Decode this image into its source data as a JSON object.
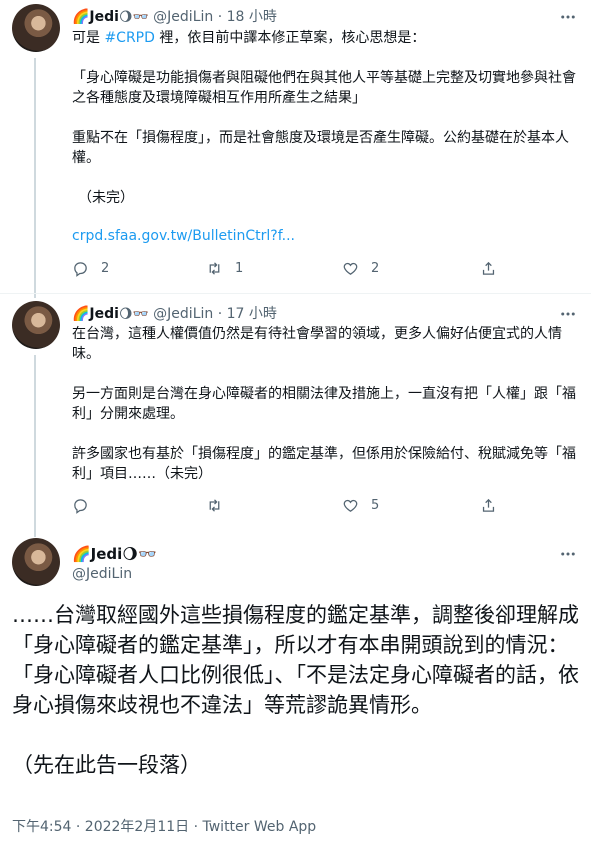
{
  "tweets": [
    {
      "name": "🌈Jedi",
      "badges": "🌖👓",
      "handle": "@JediLin",
      "sep": "·",
      "time": "18 小時",
      "line1_pre": "可是 ",
      "line1_tag": "#CRPD",
      "line1_post": " 裡，依目前中譯本修正草案，核心思想是：",
      "para2": "「身心障礙是功能損傷者與阻礙他們在與其他人平等基礎上完整及切實地參與社會之各種態度及環境障礙相互作用所產生之結果」",
      "para3": "重點不在「損傷程度」，而是社會態度及環境是否產生障礙。公約基礎在於基本人權。",
      "para4": "（未完）",
      "link": "crpd.sfaa.gov.tw/BulletinCtrl?f...",
      "reply_count": "2",
      "retweet_count": "1",
      "like_count": "2"
    },
    {
      "name": "🌈Jedi",
      "badges": "🌖👓",
      "handle": "@JediLin",
      "sep": "·",
      "time": "17 小時",
      "body": "在台灣，這種人權價值仍然是有待社會學習的領域，更多人偏好佔便宜式的人情味。\n\n另一方面則是台灣在身心障礙者的相關法律及措施上，一直沒有把「人權」跟「福利」分開來處理。\n\n許多國家也有基於「損傷程度」的鑑定基準，但係用於保險給付、稅賦減免等「福利」項目……（未完）",
      "reply_count": "",
      "retweet_count": "",
      "like_count": "5"
    }
  ],
  "main": {
    "name": "🌈Jedi",
    "badges": "🌖👓",
    "handle": "@JediLin",
    "text": "……台灣取經國外這些損傷程度的鑑定基準，調整後卻理解成「身心障礙者的鑑定基準」，所以才有本串開頭說到的情況：「身心障礙者人口比例很低」、「不是法定身心障礙者的話，依身心損傷來歧視也不違法」等荒謬詭異情形。\n\n（先在此告一段落）",
    "timestamp": "下午4:54 · 2022年2月11日 · Twitter Web App"
  }
}
